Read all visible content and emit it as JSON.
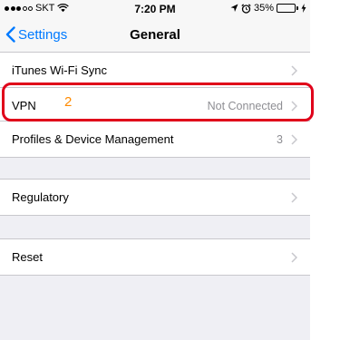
{
  "status_bar": {
    "carrier": "SKT",
    "time": "7:20 PM",
    "battery_percent": "35%",
    "battery_level": 0.35,
    "icons": [
      "signal-dots",
      "wifi-icon",
      "location-arrow-icon",
      "alarm-clock-icon",
      "battery-icon",
      "charging-bolt-icon"
    ]
  },
  "nav": {
    "back_label": "Settings",
    "title": "General"
  },
  "groups": [
    {
      "rows": [
        {
          "label": "iTunes Wi-Fi Sync"
        }
      ]
    },
    {
      "rows": [
        {
          "label": "VPN",
          "detail": "Not Connected"
        }
      ]
    },
    {
      "rows": [
        {
          "label": "Profiles & Device Management",
          "detail": "3"
        }
      ]
    },
    {
      "rows": [
        {
          "label": "Regulatory"
        }
      ]
    },
    {
      "rows": [
        {
          "label": "Reset"
        }
      ]
    }
  ],
  "annotation": {
    "number": "2",
    "box_color": "#e0001a",
    "number_color": "#ff8a00"
  },
  "colors": {
    "accent": "#007aff",
    "background": "#efeff4",
    "secondary_text": "#8e8e93",
    "separator": "#c8c7cc",
    "battery_fill": "#4cd964"
  }
}
